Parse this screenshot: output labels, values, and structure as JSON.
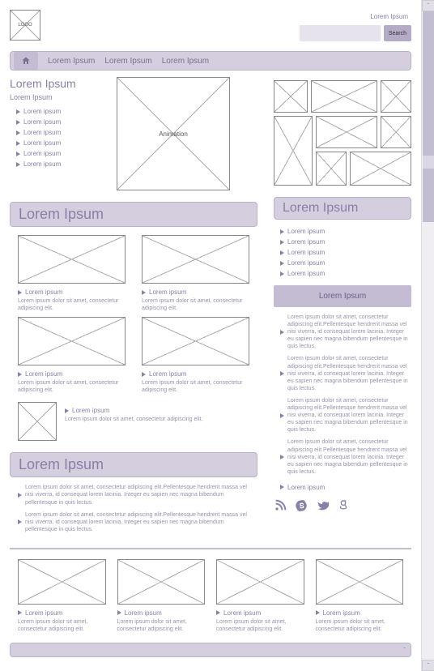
{
  "logo_text": "LOGO",
  "header_link": "Lorem Ipsum",
  "search": {
    "placeholder": "",
    "button": "Search"
  },
  "nav": {
    "items": [
      "Lorem Ipsum",
      "Lorem Ipsum",
      "Lorem Ipsum"
    ]
  },
  "hero": {
    "title": "Lorem Ipsum",
    "subtitle": "Lorem Ipsum",
    "bullets": [
      "Lorem ipsum",
      "Lorem ipsum",
      "Lorem ipsum",
      "Lorem ipsum",
      "Lorem ipsum",
      "Lorem ipsum"
    ],
    "animation_label": "Animation"
  },
  "left_section": {
    "heading": "Lorem Ipsum",
    "cards": [
      {
        "title": "Lorem ipsum",
        "desc": "Lorem ipsum dolor sit amet, consectetur adipiscing elit."
      },
      {
        "title": "Lorem ipsum",
        "desc": "Lorem ipsum dolor sit amet, consectetur adipiscing elit."
      },
      {
        "title": "Lorem ipsum",
        "desc": "Lorem ipsum dolor sit amet, consectetur adipiscing elit."
      },
      {
        "title": "Lorem ipsum",
        "desc": "Lorem ipsum dolor sit amet, consectetur adipiscing elit."
      }
    ],
    "mini": {
      "title": "Lorem ipsum",
      "desc": "Lorem ipsum dolor sit amet, consectetur adipiscing elit."
    }
  },
  "left_section2": {
    "heading": "Lorem Ipsum",
    "bullets": [
      "Lorem ipsum dolor sit amet, consectetur adipiscing elit.Pellentesque hendrerit massa vel nisi viverra, id consequat lorem lacinia. Integer eu sapien nec magna bibendum pellentesque in quis lectus.",
      "Lorem ipsum dolor sit amet, consectetur adipiscing elit.Pellentesque hendrerit massa vel nisi viverra, id consequat lorem lacinia. Integer eu sapien nec magna bibendum pellentesque in quis lectus."
    ]
  },
  "right": {
    "heading": "Lorem Ipsum",
    "bullets": [
      "Lorem ipsum",
      "Lorem ipsum",
      "Lorem ipsum",
      "Lorem ipsum",
      "Lorem ipsum"
    ],
    "box_heading": "Lorem Ipsum",
    "texts": [
      "Lorem ipsum dolor sit amet, consectetur adipiscing elit.Pellentesque hendrerit massa vel nisi viverra, id consequat lorem lacinia. Integer eu sapien nec magna bibendum pellentesque in quis lectus.",
      "Lorem ipsum dolor sit amet, consectetur adipiscing elit.Pellentesque hendrerit massa vel nisi viverra, id consequat lorem lacinia. Integer eu sapien nec magna bibendum pellentesque in quis lectus.",
      "Lorem ipsum dolor sit amet, consectetur adipiscing elit.Pellentesque hendrerit massa vel nisi viverra, id consequat lorem lacinia. Integer eu sapien nec magna bibendum pellentesque in quis lectus.",
      "Lorem ipsum dolor sit amet, consectetur adipiscing elit.Pellentesque hendrerit massa vel nisi viverra, id consequat lorem lacinia. Integer eu sapien nec magna bibendum pellentesque in quis lectus."
    ],
    "final_bullet": "Lorem ipsum"
  },
  "bottom": {
    "cards": [
      {
        "title": "Lorem ipsum",
        "desc": "Lorem ipsum dolor sit amet, consectetur adipiscing elit."
      },
      {
        "title": "Lorem ipsum",
        "desc": "Lorem ipsum dolor sit amet, consectetur adipiscing elit."
      },
      {
        "title": "Lorem ipsum",
        "desc": "Lorem ipsum dolor sit amet, consectetur adipiscing elit."
      },
      {
        "title": "Lorem ipsum",
        "desc": "Lorem ipsum dolor sit amet, consectetur adipiscing elit."
      }
    ]
  }
}
